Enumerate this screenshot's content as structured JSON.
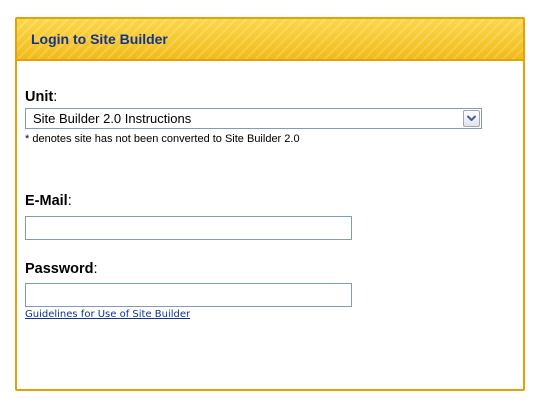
{
  "panel": {
    "title": "Login to Site Builder"
  },
  "unit": {
    "label": "Unit",
    "colon": ":",
    "selected": "Site Builder 2.0 Instructions",
    "note": "* denotes site has not been converted to Site Builder 2.0"
  },
  "email": {
    "label": "E-Mail",
    "colon": ":",
    "value": ""
  },
  "password": {
    "label": "Password",
    "colon": ":",
    "value": ""
  },
  "links": {
    "guidelines": "Guidelines for Use of Site Builder"
  },
  "icons": {
    "dropdown": "chevron-down-icon"
  },
  "colors": {
    "header_bg": "#f6c62b",
    "border": "#e3a20d",
    "title_text": "#12348c",
    "link_text": "#12348c",
    "input_border": "#7f9db9"
  }
}
